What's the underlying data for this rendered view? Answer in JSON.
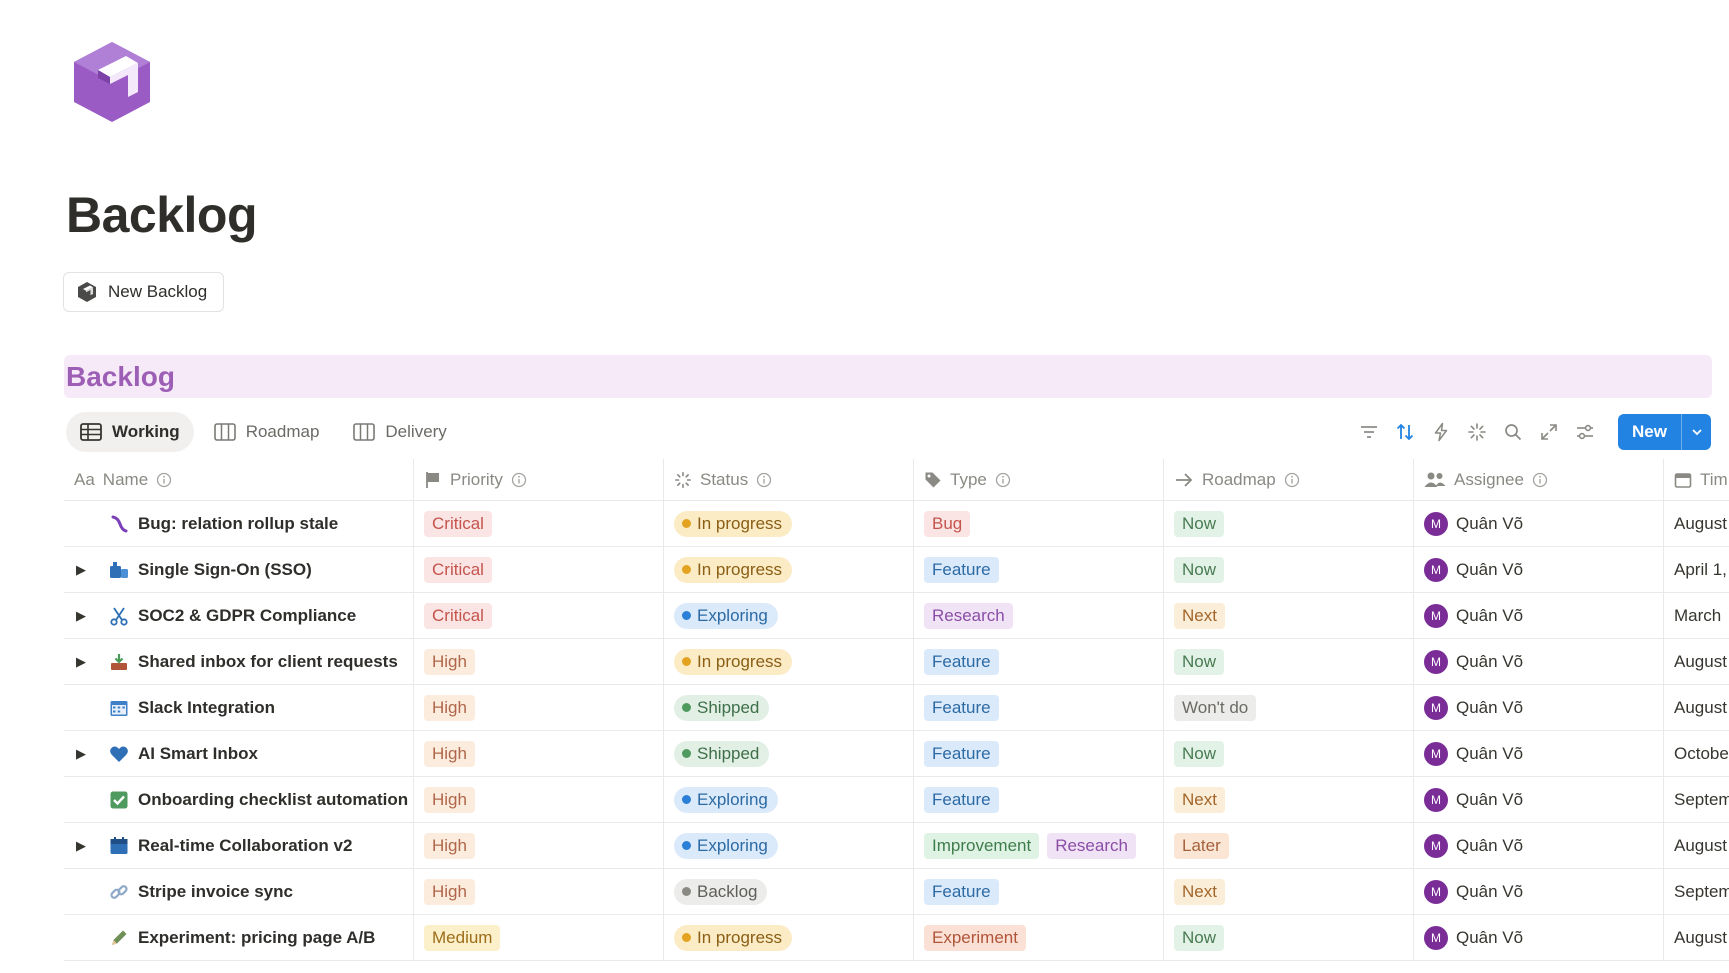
{
  "colors": {
    "accent_blue": "#2383e2",
    "title_purple": "#9d5fb6",
    "header_band": "#f6e9f8",
    "avatar": "#7b2d97"
  },
  "page": {
    "title": "Backlog",
    "new_button_label": "New Backlog",
    "db_title": "Backlog"
  },
  "views": [
    {
      "label": "Working",
      "icon": "table-icon"
    },
    {
      "label": "Roadmap",
      "icon": "board-icon"
    },
    {
      "label": "Delivery",
      "icon": "board-icon"
    }
  ],
  "toolbar": {
    "new_label": "New",
    "icons": [
      "filter-icon",
      "sort-icon",
      "automation-icon",
      "ai-icon",
      "search-icon",
      "expand-icon",
      "settings-icon",
      "chevron-down-icon"
    ]
  },
  "columns": [
    {
      "label": "Name",
      "icon": "text-icon"
    },
    {
      "label": "Priority",
      "icon": "flag-icon"
    },
    {
      "label": "Status",
      "icon": "status-icon"
    },
    {
      "label": "Type",
      "icon": "tag-icon"
    },
    {
      "label": "Roadmap",
      "icon": "arrow-right-icon"
    },
    {
      "label": "Assignee",
      "icon": "people-icon"
    },
    {
      "label": "Tim",
      "icon": "calendar-icon"
    }
  ],
  "rows": [
    {
      "name": "Bug: relation rollup stale",
      "toggle": false,
      "icon": "bug-icon",
      "priority": "Critical",
      "status": "In progress",
      "types": [
        "Bug"
      ],
      "roadmap": "Now",
      "assignee": "Quân Võ",
      "avatar": "M",
      "time": "August"
    },
    {
      "name": "Single Sign-On (SSO)",
      "toggle": true,
      "icon": "briefcase-icon",
      "priority": "Critical",
      "status": "In progress",
      "types": [
        "Feature"
      ],
      "roadmap": "Now",
      "assignee": "Quân Võ",
      "avatar": "M",
      "time": "April 1,"
    },
    {
      "name": "SOC2 & GDPR Compliance",
      "toggle": true,
      "icon": "scissors-icon",
      "priority": "Critical",
      "status": "Exploring",
      "types": [
        "Research"
      ],
      "roadmap": "Next",
      "assignee": "Quân Võ",
      "avatar": "M",
      "time": "March"
    },
    {
      "name": "Shared inbox for client requests",
      "toggle": true,
      "icon": "inbox-tray-icon",
      "priority": "High",
      "status": "In progress",
      "types": [
        "Feature"
      ],
      "roadmap": "Now",
      "assignee": "Quân Võ",
      "avatar": "M",
      "time": "August"
    },
    {
      "name": "Slack Integration",
      "toggle": false,
      "icon": "calendar-grid-icon",
      "priority": "High",
      "status": "Shipped",
      "types": [
        "Feature"
      ],
      "roadmap": "Won't do",
      "assignee": "Quân Võ",
      "avatar": "M",
      "time": "August"
    },
    {
      "name": "AI Smart Inbox",
      "toggle": true,
      "icon": "heart-icon",
      "priority": "High",
      "status": "Shipped",
      "types": [
        "Feature"
      ],
      "roadmap": "Now",
      "assignee": "Quân Võ",
      "avatar": "M",
      "time": "Octobe"
    },
    {
      "name": "Onboarding checklist automation",
      "toggle": false,
      "icon": "checkbox-icon",
      "priority": "High",
      "status": "Exploring",
      "types": [
        "Feature"
      ],
      "roadmap": "Next",
      "assignee": "Quân Võ",
      "avatar": "M",
      "time": "Septem"
    },
    {
      "name": "Real-time Collaboration v2",
      "toggle": true,
      "icon": "calendar-blue-icon",
      "priority": "High",
      "status": "Exploring",
      "types": [
        "Improvement",
        "Research"
      ],
      "roadmap": "Later",
      "assignee": "Quân Võ",
      "avatar": "M",
      "time": "August"
    },
    {
      "name": "Stripe invoice sync",
      "toggle": false,
      "icon": "link-icon",
      "priority": "High",
      "status": "Backlog",
      "types": [
        "Feature"
      ],
      "roadmap": "Next",
      "assignee": "Quân Võ",
      "avatar": "M",
      "time": "Septem"
    },
    {
      "name": "Experiment: pricing page A/B",
      "toggle": false,
      "icon": "pencil-icon",
      "priority": "Medium",
      "status": "In progress",
      "types": [
        "Experiment"
      ],
      "roadmap": "Now",
      "assignee": "Quân Võ",
      "avatar": "M",
      "time": "August"
    }
  ]
}
